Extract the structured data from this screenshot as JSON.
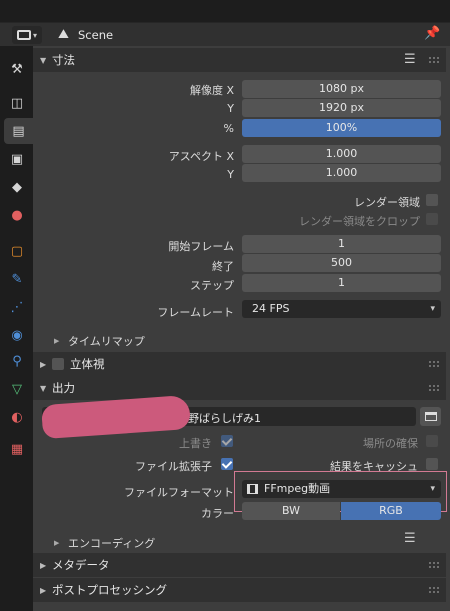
{
  "header": {
    "context_label": "Scene"
  },
  "tabs": [
    {
      "name": "tool-tab-icon",
      "color": "#d5d5d5",
      "glyph": "⚒"
    },
    {
      "name": "render-tab-icon",
      "color": "#d5d5d5",
      "glyph": "◫"
    },
    {
      "name": "output-tab-icon",
      "color": "#d5d5d5",
      "glyph": "▤"
    },
    {
      "name": "view-layer-tab-icon",
      "color": "#d5d5d5",
      "glyph": "▣"
    },
    {
      "name": "scene-tab-icon",
      "color": "#d5d5d5",
      "glyph": "◆"
    },
    {
      "name": "world-tab-icon",
      "color": "#e06060",
      "glyph": "●"
    },
    {
      "name": "object-tab-icon",
      "color": "#e08a2c",
      "glyph": "▢"
    },
    {
      "name": "modifier-tab-icon",
      "color": "#4f8fd8",
      "glyph": "✎"
    },
    {
      "name": "particles-tab-icon",
      "color": "#4f8fd8",
      "glyph": "⋰"
    },
    {
      "name": "physics-tab-icon",
      "color": "#4f8fd8",
      "glyph": "◉"
    },
    {
      "name": "constraints-tab-icon",
      "color": "#4f8fd8",
      "glyph": "⚲"
    },
    {
      "name": "data-tab-icon",
      "color": "#56c07a",
      "glyph": "▽"
    },
    {
      "name": "material-tab-icon",
      "color": "#e06060",
      "glyph": "◐"
    },
    {
      "name": "texture-tab-icon",
      "color": "#e06060",
      "glyph": "▦"
    }
  ],
  "dimensions": {
    "title": "寸法",
    "res_x_label": "解像度 X",
    "res_x": "1080 px",
    "res_y_label": "Y",
    "res_y": "1920 px",
    "pct_label": "%",
    "pct": "100%",
    "aspect_x_label": "アスペクト X",
    "aspect_x": "1.000",
    "aspect_y_label": "Y",
    "aspect_y": "1.000",
    "render_region": "レンダー領域",
    "crop_region": "レンダー領域をクロップ",
    "frame_start_label": "開始フレーム",
    "frame_start": "1",
    "frame_end_label": "終了",
    "frame_end": "500",
    "frame_step_label": "ステップ",
    "frame_step": "1",
    "frame_rate_label": "フレームレート",
    "frame_rate": "24 FPS",
    "time_remap": "タイムリマップ"
  },
  "stereoscopy": {
    "title": "立体視"
  },
  "output": {
    "title": "出力",
    "path": "野ばらしげみ1",
    "overwrite": "上書き",
    "placeholders": "場所の確保",
    "file_extension": "ファイル拡張子",
    "cache_result": "結果をキャッシュ",
    "file_format_label": "ファイルフォーマット",
    "file_format": "FFmpeg動画",
    "color_label": "カラー",
    "color_bw": "BW",
    "color_rgb": "RGB",
    "encoding": "エンコーディング"
  },
  "metadata": {
    "title": "メタデータ"
  },
  "post_processing": {
    "title": "ポストプロセッシング"
  }
}
